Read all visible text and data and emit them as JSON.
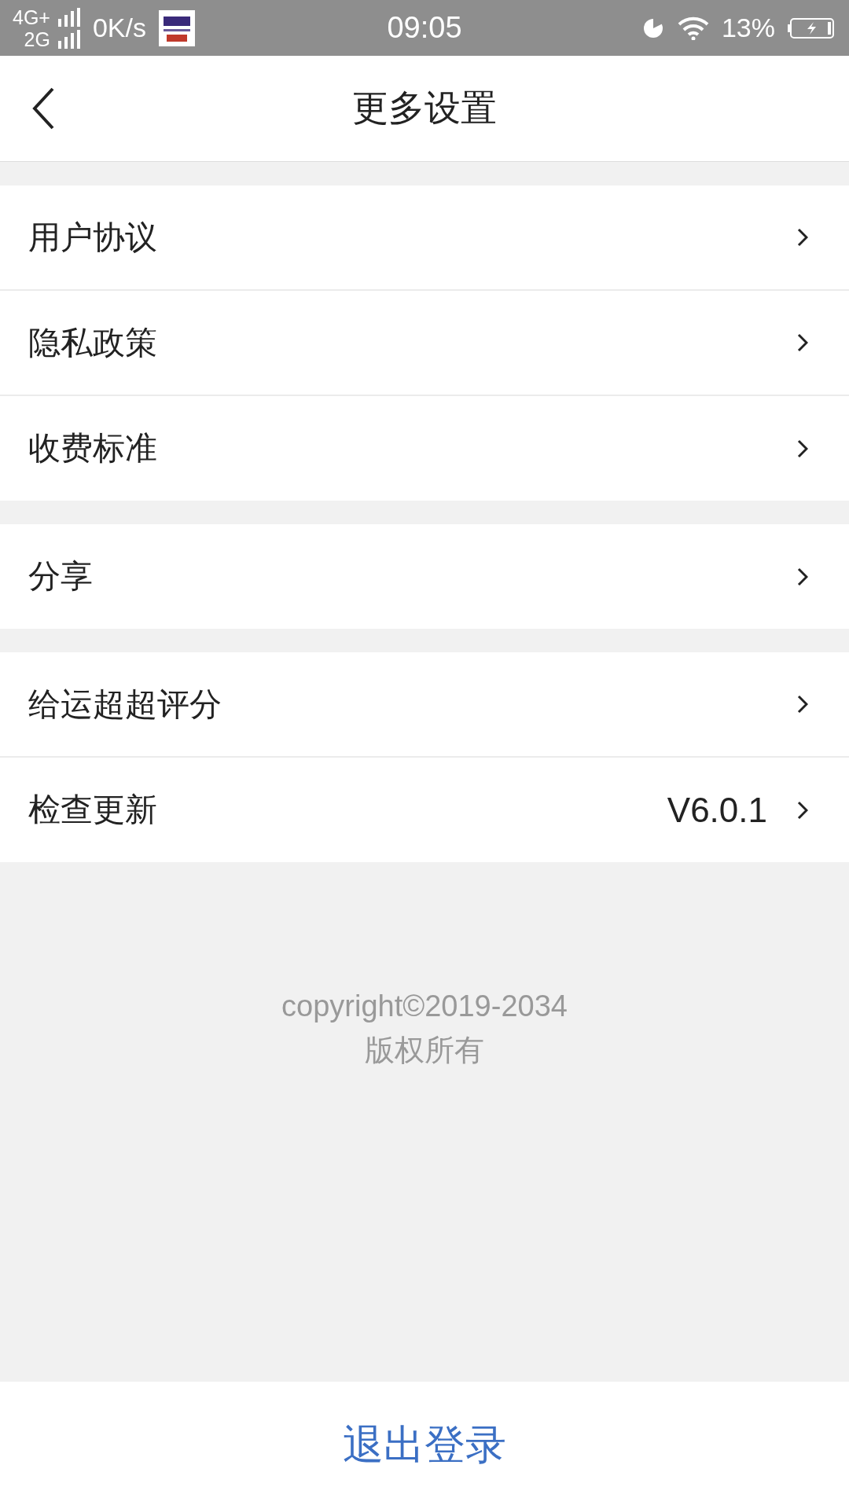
{
  "status_bar": {
    "network_primary": "4G+",
    "network_secondary": "2G",
    "speed": "0K/s",
    "time": "09:05",
    "battery": "13%"
  },
  "header": {
    "title": "更多设置"
  },
  "groups": [
    {
      "items": [
        {
          "label": "用户协议"
        },
        {
          "label": "隐私政策"
        },
        {
          "label": "收费标准"
        }
      ]
    },
    {
      "items": [
        {
          "label": "分享"
        }
      ]
    },
    {
      "items": [
        {
          "label": "给运超超评分"
        },
        {
          "label": "检查更新",
          "value": "V6.0.1"
        }
      ]
    }
  ],
  "footer_text": [
    "copyright©2019-2034",
    "版权所有"
  ],
  "logout_button": "退出登录"
}
